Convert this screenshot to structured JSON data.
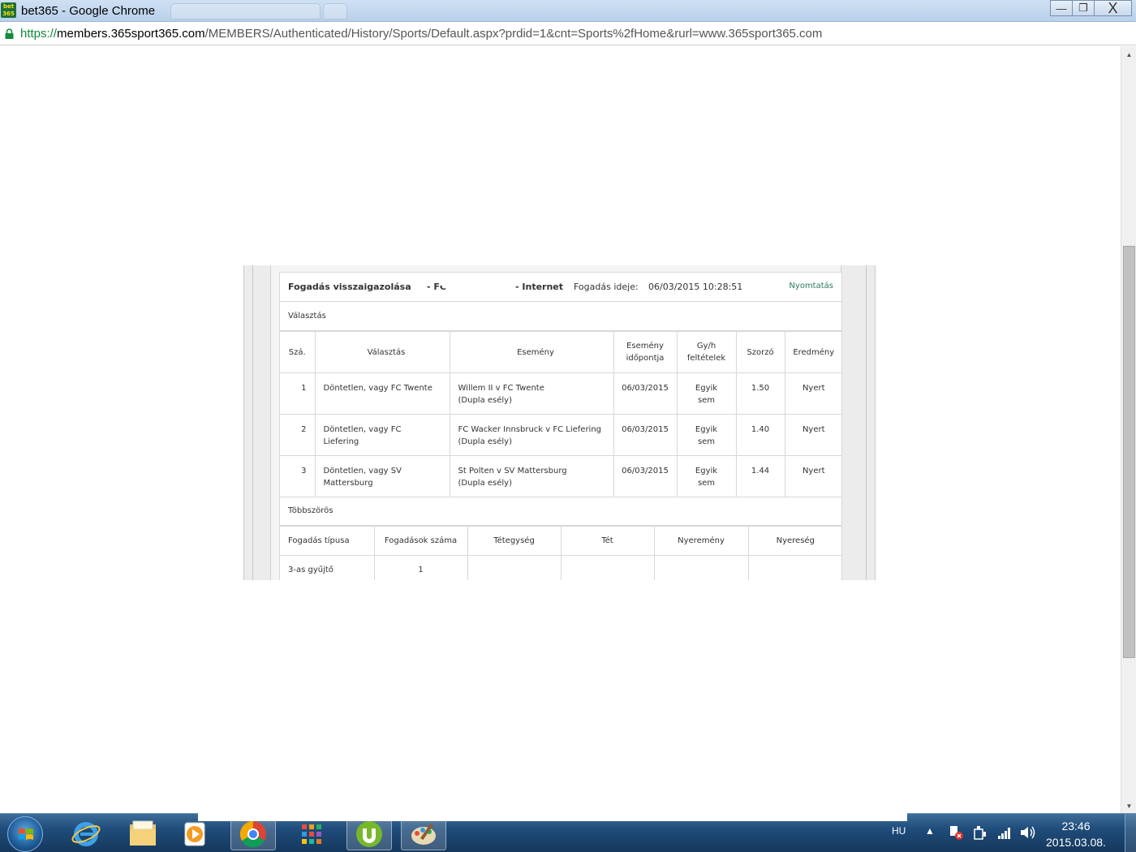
{
  "window": {
    "title": "bet365 - Google Chrome",
    "app_icon_text_top": "bet",
    "app_icon_text_bottom": "365",
    "controls": {
      "minimize": "—",
      "maximize": "❐",
      "close": "X"
    }
  },
  "address_bar": {
    "scheme": "https://",
    "host": "members.365sport365.com",
    "path": "/MEMBERS/Authenticated/History/Sports/Default.aspx?prdid=1&cnt=Sports%2fHome&rurl=www.365sport365.com"
  },
  "bet": {
    "title": "Fogadás visszaigazolása",
    "reference": "- FC",
    "channel": "- Internet",
    "time_label": "Fogadás ideje:",
    "time_value": "06/03/2015 10:28:51",
    "print_link": "Nyomtatás",
    "selections_heading": "Választás",
    "selection_columns": [
      "Szá.",
      "Választás",
      "Esemény",
      "Esemény időpontja",
      "Gy/h feltételek",
      "Szorzó",
      "Eredmény"
    ],
    "selections": [
      {
        "no": "1",
        "choice": "Döntetlen, vagy FC Twente",
        "event": "Willem II v FC Twente",
        "market": "(Dupla esély)",
        "date": "06/03/2015",
        "terms": "Egyik sem",
        "odds": "1.50",
        "result": "Nyert"
      },
      {
        "no": "2",
        "choice": "Döntetlen, vagy FC Liefering",
        "event": "FC Wacker Innsbruck v FC Liefering",
        "market": "(Dupla esély)",
        "date": "06/03/2015",
        "terms": "Egyik sem",
        "odds": "1.40",
        "result": "Nyert"
      },
      {
        "no": "3",
        "choice": "Döntetlen, vagy SV Mattersburg",
        "event": "St Polten v SV Mattersburg",
        "market": "(Dupla esély)",
        "date": "06/03/2015",
        "terms": "Egyik sem",
        "odds": "1.44",
        "result": "Nyert"
      }
    ],
    "multiples_heading": "Többszörös",
    "multiple_columns": [
      "Fogadás típusa",
      "Fogadások száma",
      "Tétegység",
      "Tét",
      "Nyeremény",
      "Nyereség"
    ],
    "multiples": [
      {
        "type": "3-as gyűjtő",
        "count": "1"
      }
    ]
  },
  "taskbar": {
    "pinned": [
      "internet-explorer-icon",
      "folder-icon",
      "media-player-icon",
      "chrome-icon",
      "apps-grid-icon",
      "utorrent-icon",
      "paint-icon"
    ],
    "language": "HU",
    "time": "23:46",
    "date": "2015.03.08."
  }
}
